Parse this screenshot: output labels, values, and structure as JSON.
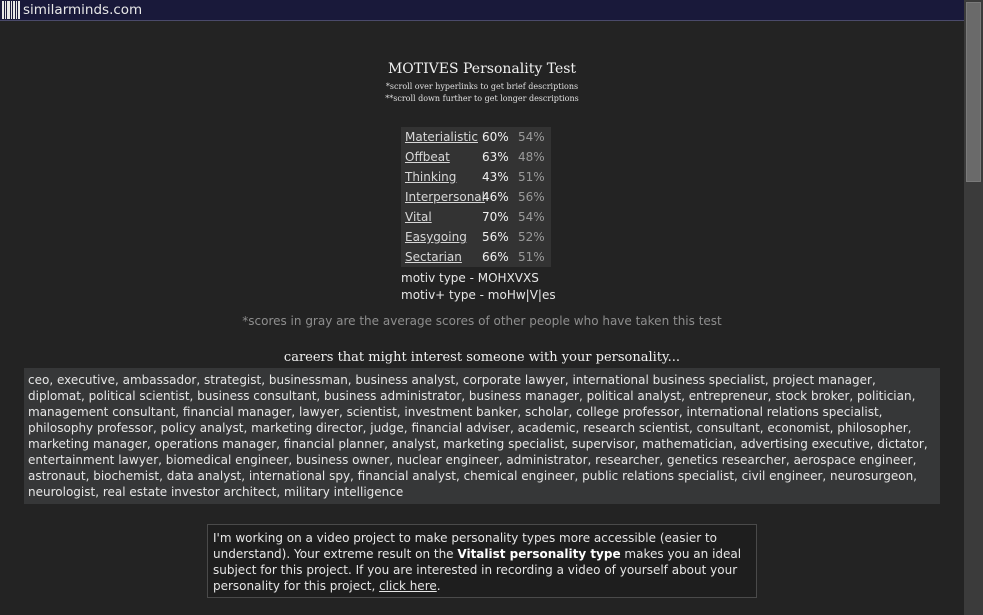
{
  "header": {
    "site_name": "similarminds.com"
  },
  "title": "MOTIVES Personality Test",
  "notes": [
    "*scroll over hyperlinks to get brief descriptions",
    "**scroll down further to get longer descriptions"
  ],
  "scores": [
    {
      "trait": "Materialistic",
      "score": "60%",
      "average": "54%"
    },
    {
      "trait": "Offbeat",
      "score": "63%",
      "average": "48%"
    },
    {
      "trait": "Thinking",
      "score": "43%",
      "average": "51%"
    },
    {
      "trait": "Interpersonal",
      "score": "46%",
      "average": "56%"
    },
    {
      "trait": "Vital",
      "score": "70%",
      "average": "54%"
    },
    {
      "trait": "Easygoing",
      "score": "56%",
      "average": "52%"
    },
    {
      "trait": "Sectarian",
      "score": "66%",
      "average": "51%"
    }
  ],
  "motiv_type": "motiv type - MOHXVXS",
  "motiv_plus_type": "motiv+ type - moHw|V|es",
  "gray_note": "*scores in gray are the average scores of other people who have taken this test",
  "careers_heading": "careers that might interest someone with your personality...",
  "careers_text": "ceo, executive, ambassador, strategist, businessman, business analyst, corporate lawyer, international business specialist, project manager, diplomat, political scientist, business consultant, business administrator, business manager, political analyst, entrepreneur, stock broker, politician, management consultant, financial manager, lawyer, scientist, investment banker, scholar, college professor, international relations specialist, philosophy professor, policy analyst, marketing director, judge, financial adviser, academic, research scientist, consultant, economist, philosopher, marketing manager, operations manager, financial planner, analyst, marketing specialist, supervisor, mathematician, advertising executive, dictator, entertainment lawyer, biomedical engineer, business owner, nuclear engineer, administrator, researcher, genetics researcher, aerospace engineer, astronaut, biochemist, data analyst, international spy, financial analyst, chemical engineer, public relations specialist, civil engineer, neurosurgeon, neurologist, real estate investor architect, military intelligence",
  "promo": {
    "text_1": "I'm working on a video project to make personality types more accessible (easier to understand). Your extreme result on the ",
    "bold": "Vitalist personality type",
    "text_2": " makes you an ideal subject for this project. If you are interested in recording a video of yourself about your personality for this project, ",
    "link": "click here",
    "text_3": "."
  }
}
